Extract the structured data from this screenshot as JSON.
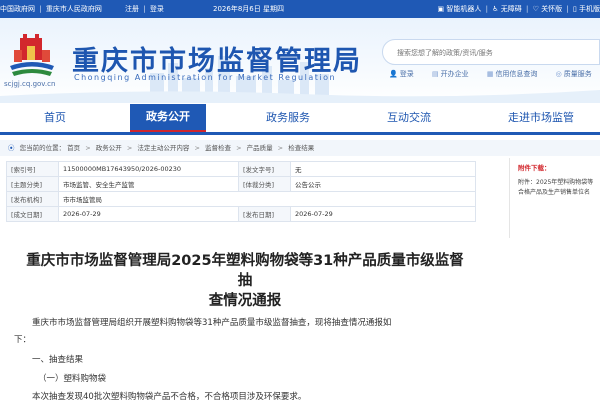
{
  "topbar": {
    "gov_link": "中国政府网",
    "sep": "|",
    "cq_link": "重庆市人民政府网",
    "register": "注册",
    "login": "登录",
    "date": "2026年8月6日 星期四",
    "right_items": [
      "智能机器人",
      "无障碍",
      "关怀版",
      "手机版"
    ]
  },
  "header": {
    "title": "重庆市市场监督管理局",
    "subtitle": "Chongqing Administration for Market Regulation",
    "domain": "scjgj.cq.gov.cn",
    "search_placeholder": "搜索您想了解的政策/资讯/服务",
    "quick_links": [
      "登录",
      "开办企业",
      "信用信息查询",
      "质量服务"
    ]
  },
  "nav": {
    "items": [
      "首页",
      "政务公开",
      "政务服务",
      "互动交流",
      "走进市场监管"
    ]
  },
  "breadcrumb": {
    "prefix": "您当前的位置：",
    "items": [
      "首页",
      "政务公开",
      "法定主动公开内容",
      "监督检查",
      "产品质量",
      "检查结果"
    ],
    "arrow": ">"
  },
  "meta": {
    "rows": [
      {
        "k1": "[索引号]",
        "v1": "11500000MB17643950/2026-00230",
        "k2": "[发文字号]",
        "v2": "无"
      },
      {
        "k1": "[主题分类]",
        "v1": "市场监管、安全生产监管",
        "k2": "[体裁分类]",
        "v2": "公告公示"
      },
      {
        "k1": "[发布机构]",
        "v1": "市市场监管局",
        "k2": "",
        "v2": ""
      },
      {
        "k1": "[成文日期]",
        "v1": "2026-07-29",
        "k2": "[发布日期]",
        "v2": "2026-07-29"
      }
    ]
  },
  "sidebar": {
    "title": "附件下载：",
    "items": [
      "附件：2025年塑料购物袋等",
      "合格产品及生产销售单位名"
    ]
  },
  "article": {
    "title_line1": "重庆市市场监督管理局2025年塑料购物袋等31种产品质量市级监督抽",
    "title_line2": "查情况通报",
    "p1": "重庆市市场监督管理局组织开展塑料购物袋等31种产品质量市级监督抽查，现将抽查情况通报如",
    "p1b": "下：",
    "h1": "一、抽查结果",
    "h2": "（一）塑料购物袋",
    "p2": "本次抽查发现40批次塑料购物袋产品不合格，不合格项目涉及环保要求。"
  },
  "colors": {
    "primary": "#1f59b5",
    "accent": "#d2272d"
  }
}
